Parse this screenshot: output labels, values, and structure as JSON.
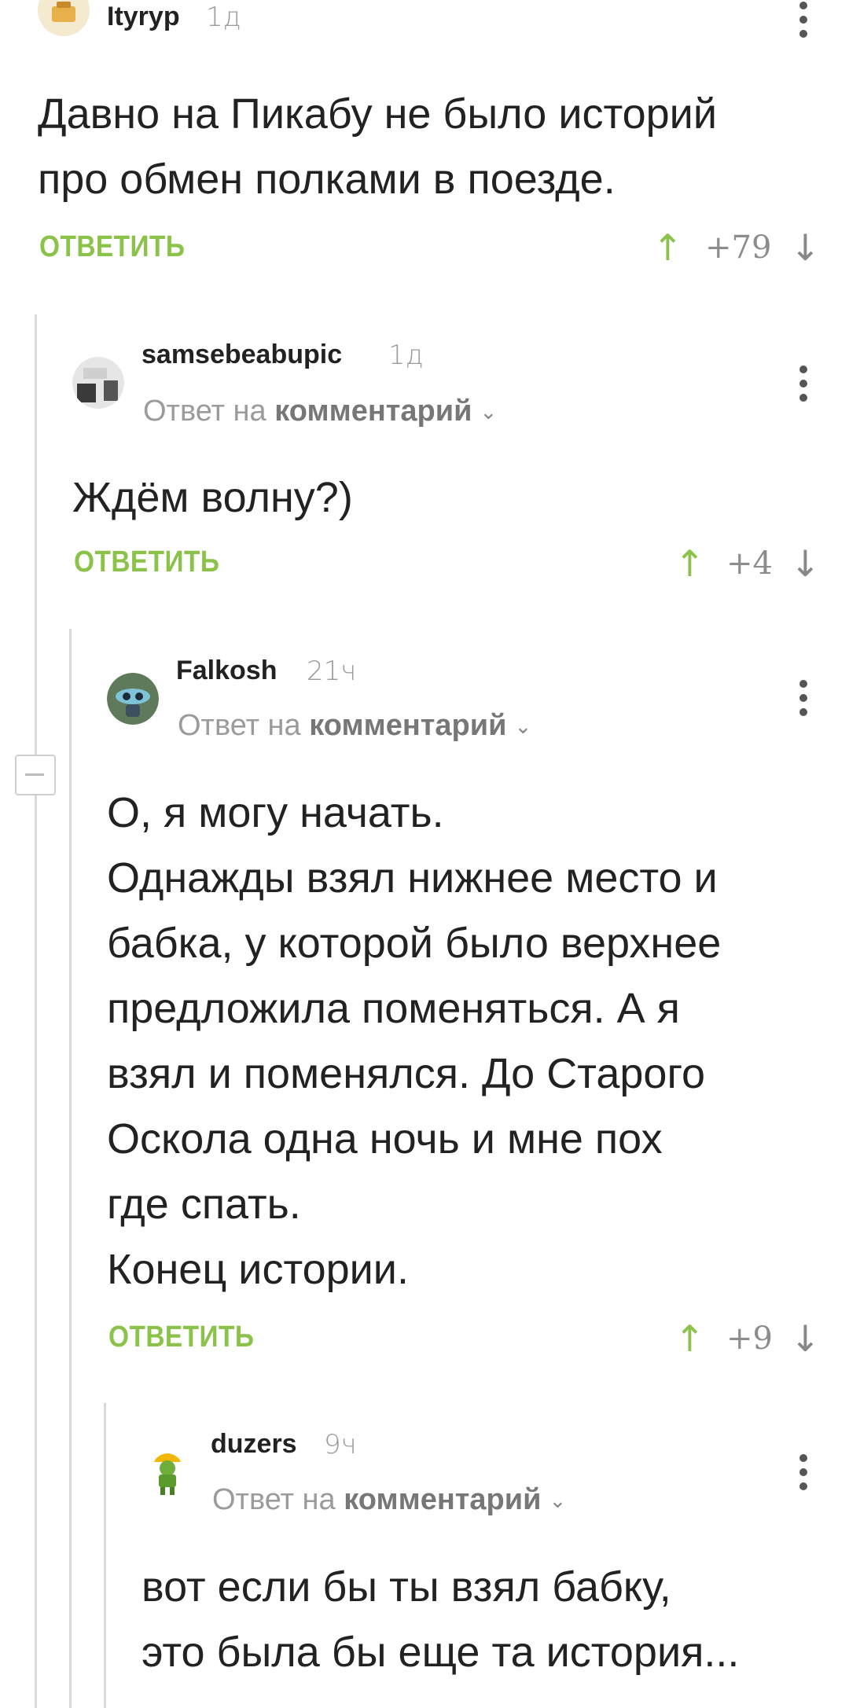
{
  "comments": [
    {
      "username": "Ityryp",
      "time": "1д",
      "text": "Давно на Пикабу не было историй\nпро обмен полками в поезде.",
      "reply_label": "ОТВЕТИТЬ",
      "rating": "+79"
    },
    {
      "username": "samsebeabupic",
      "time": "1д",
      "reply_to_prefix": "Ответ на",
      "reply_to_target": "комментарий",
      "text": "Ждём волну?)",
      "reply_label": "ОТВЕТИТЬ",
      "rating": "+4"
    },
    {
      "username": "Falkosh",
      "time": "21ч",
      "reply_to_prefix": "Ответ на",
      "reply_to_target": "комментарий",
      "text": "О, я могу начать.\nОднажды взял нижнее место и\nбабка, у которой было верхнее\nпредложила поменяться. А я\nвзял и поменялся. До Старого\nОскола одна ночь и мне пох\nгде спать.\nКонец истории.",
      "reply_label": "ОТВЕТИТЬ",
      "rating": "+9"
    },
    {
      "username": "duzers",
      "time": "9ч",
      "reply_to_prefix": "Ответ на",
      "reply_to_target": "комментарий",
      "text": "вот если бы ты взял бабку,\nэто была бы еще та история..."
    }
  ],
  "icons": {
    "upvote": "↑",
    "downvote": "↓",
    "chevron": "⌄",
    "more": "vertical-dots",
    "collapse": "minus"
  },
  "colors": {
    "accent_green": "#8bc34a",
    "muted_text": "#9b9b9b",
    "thread_line": "#d9d9d9"
  }
}
